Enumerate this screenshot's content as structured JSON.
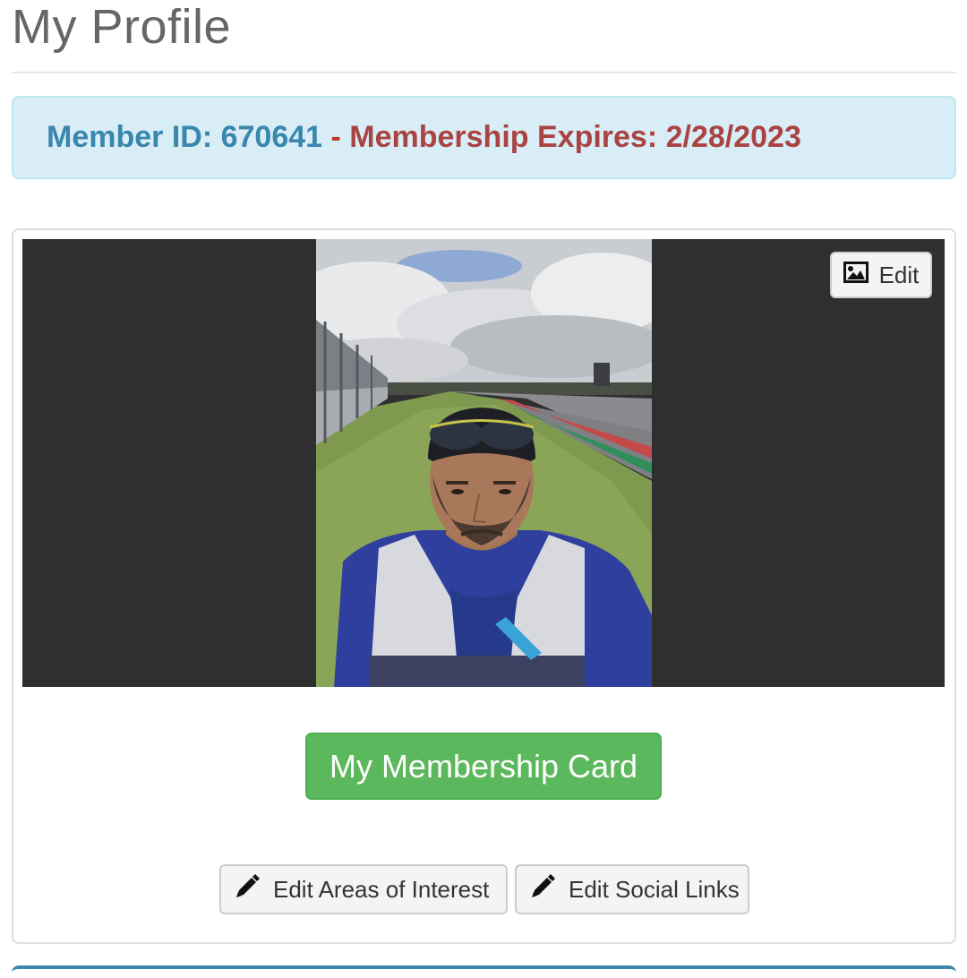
{
  "page": {
    "title": "My Profile"
  },
  "membership": {
    "member_id_label": "Member ID: 670641",
    "separator": " - ",
    "expires_label": "Membership Expires: 2/28/2023",
    "colors": {
      "member_id": "#3a87ad",
      "expires": "#a94442",
      "alert_background": "#d9edf7"
    }
  },
  "profile_photo": {
    "icon": "image-icon",
    "edit_label": "Edit"
  },
  "actions": {
    "membership_card_label": "My Membership Card",
    "edit_interests_label": "Edit Areas of Interest",
    "edit_social_label": "Edit Social Links",
    "edit_icon": "pencil-icon",
    "colors": {
      "primary_button": "#5cb85c"
    }
  }
}
